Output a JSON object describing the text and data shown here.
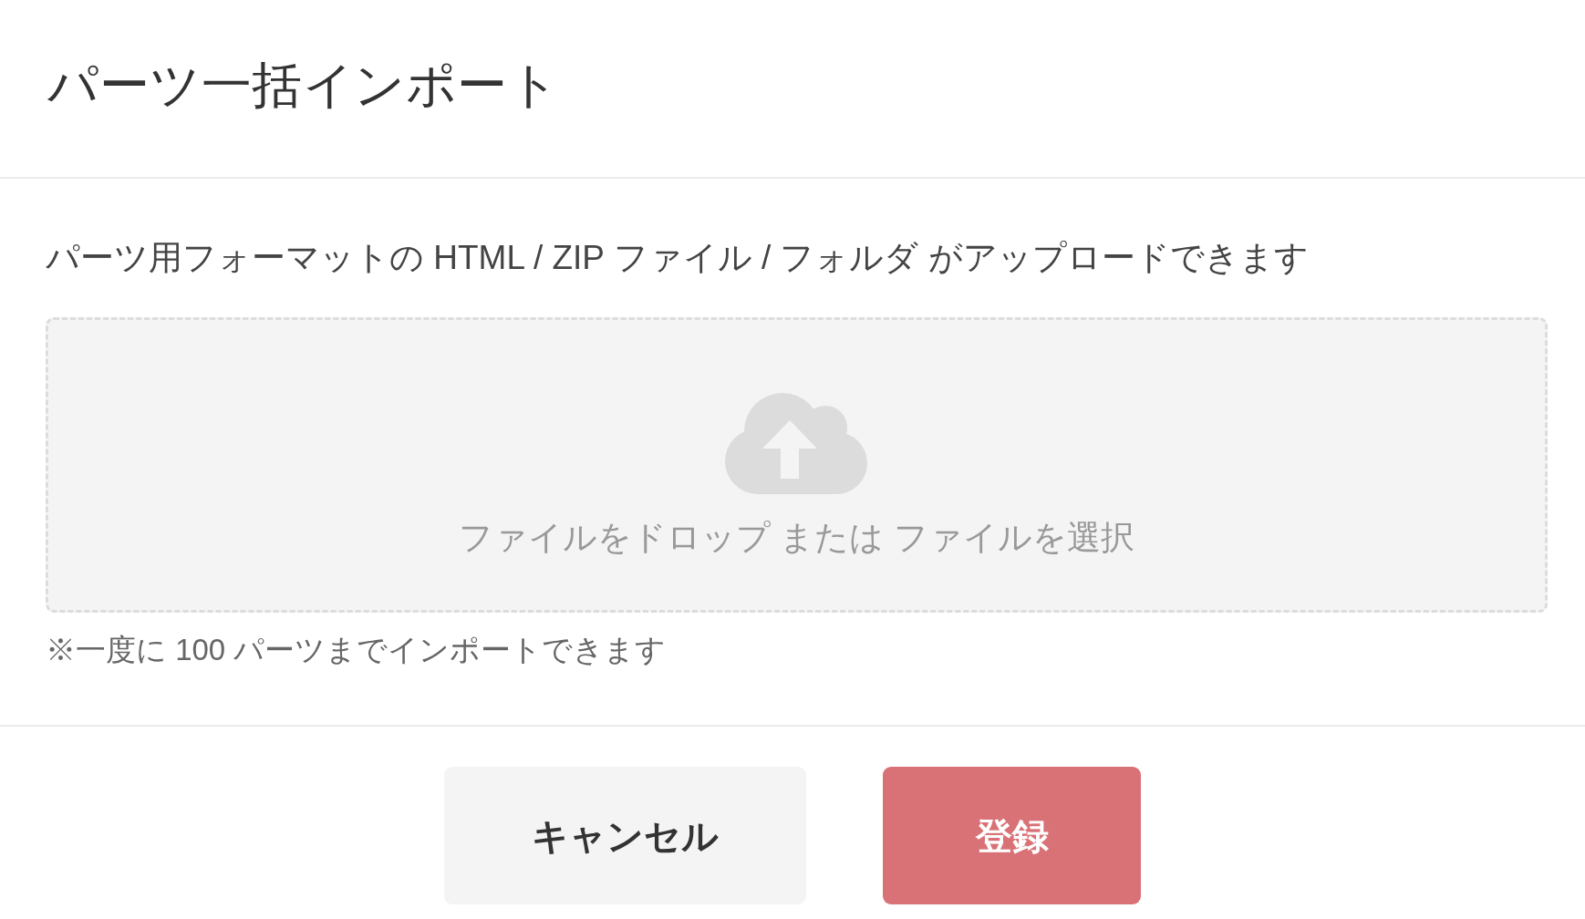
{
  "dialog": {
    "title": "パーツ一括インポート"
  },
  "description": "パーツ用フォーマットの HTML / ZIP ファイル / フォルダ がアップロードできます",
  "drop_zone": {
    "text": "ファイルをドロップ または ファイルを選択"
  },
  "note": "※一度に 100 パーツまでインポートできます",
  "buttons": [
    {
      "label": "キャンセル",
      "kind": "secondary"
    },
    {
      "label": "登録",
      "kind": "primary"
    }
  ]
}
